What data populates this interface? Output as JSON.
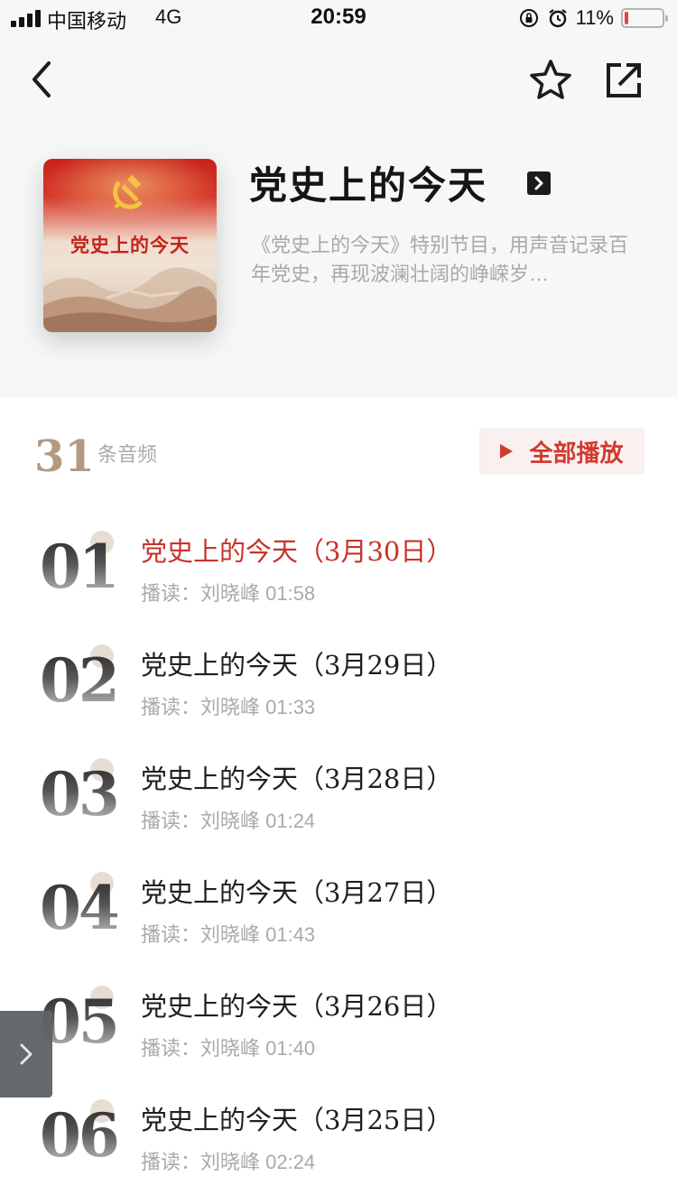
{
  "status_bar": {
    "carrier": "中国移动",
    "network": "4G",
    "time": "20:59",
    "battery": "11%",
    "battery_level": 0.11
  },
  "album": {
    "cover_text": "党史上的今天",
    "title": "党史上的今天",
    "description": "《党史上的今天》特别节目，用声音记录百年党史，再现波澜壮阔的峥嵘岁…"
  },
  "list_header": {
    "count": "31",
    "count_label": "条音频",
    "play_all": "全部播放"
  },
  "episodes": [
    {
      "num": "01",
      "title": "党史上的今天（3月30日）",
      "meta": "播读：刘晓峰 01:58",
      "active": true
    },
    {
      "num": "02",
      "title": "党史上的今天（3月29日）",
      "meta": "播读：刘晓峰 01:33"
    },
    {
      "num": "03",
      "title": "党史上的今天（3月28日）",
      "meta": "播读：刘晓峰 01:24"
    },
    {
      "num": "04",
      "title": "党史上的今天（3月27日）",
      "meta": "播读：刘晓峰 01:43"
    },
    {
      "num": "05",
      "title": "党史上的今天（3月26日）",
      "meta": "播读：刘晓峰 01:40"
    },
    {
      "num": "06",
      "title": "党史上的今天（3月25日）",
      "meta": "播读：刘晓峰 02:24"
    }
  ],
  "colors": {
    "accent": "#d23a2e",
    "count_tan": "#b29a82",
    "header_bg": "#f6f7f7"
  },
  "icons": {
    "back": "chevron-left-icon",
    "favorite": "star-outline-icon",
    "share": "share-out-icon",
    "title_more": "chevron-right-box-icon",
    "play_all": "play-triangle-icon",
    "side_tab": "chevron-right-icon"
  }
}
